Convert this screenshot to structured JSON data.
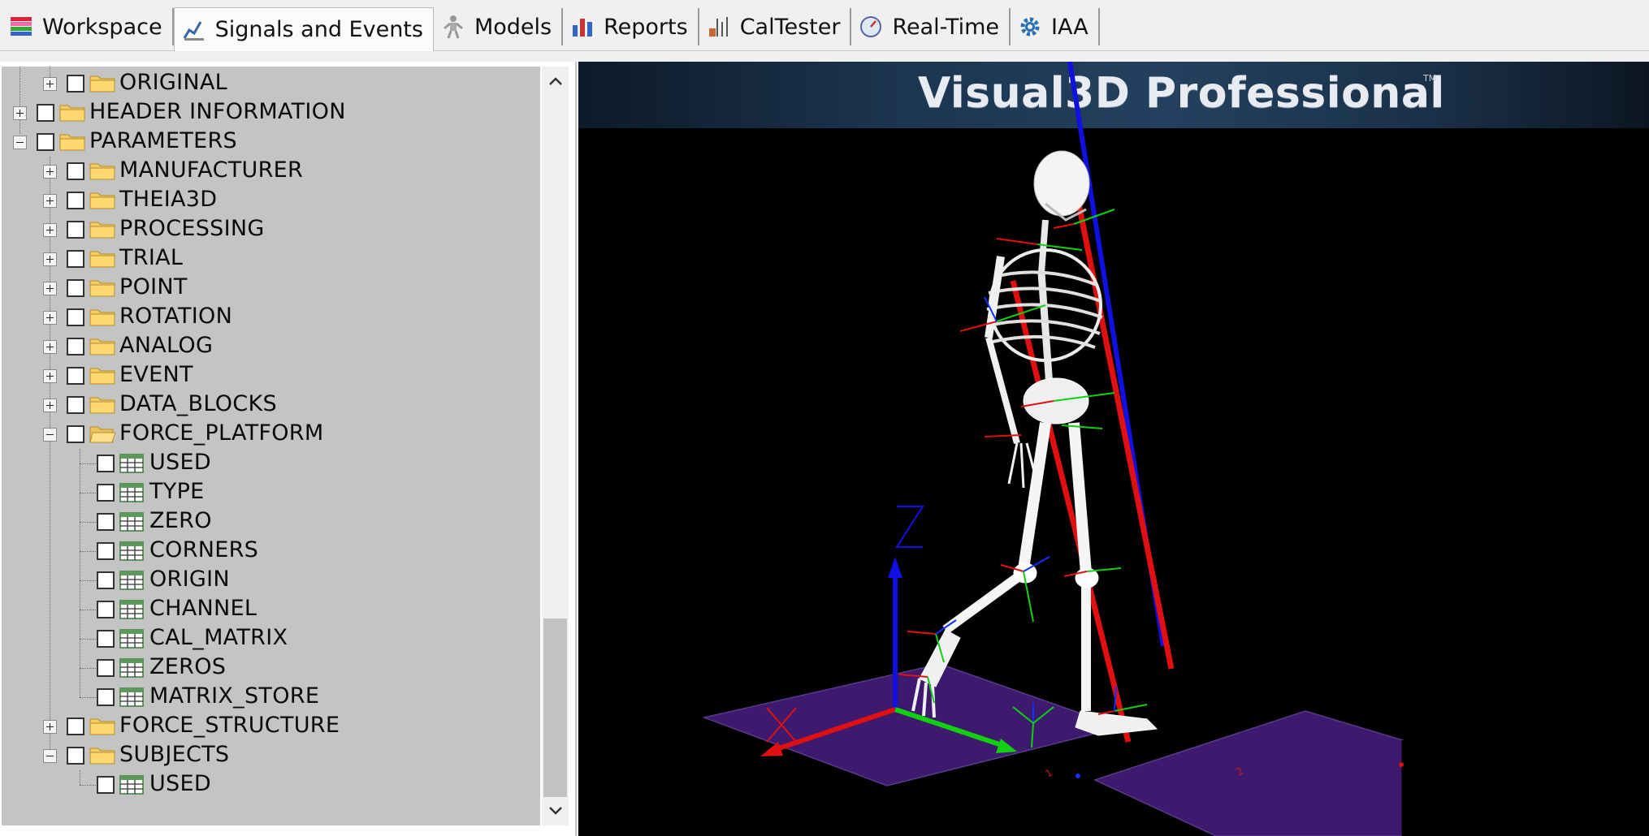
{
  "tabs": [
    {
      "label": "Workspace",
      "icon": "workspace-icon",
      "active": false
    },
    {
      "label": "Signals and Events",
      "icon": "signals-icon",
      "active": true
    },
    {
      "label": "Models",
      "icon": "models-icon",
      "active": false
    },
    {
      "label": "Reports",
      "icon": "reports-icon",
      "active": false
    },
    {
      "label": "CalTester",
      "icon": "caltester-icon",
      "active": false
    },
    {
      "label": "Real-Time",
      "icon": "realtime-icon",
      "active": false
    },
    {
      "label": "IAA",
      "icon": "gear-icon",
      "active": false
    }
  ],
  "tree": [
    {
      "label": "ORIGINAL",
      "level": 1,
      "kind": "folder",
      "expander": "plus"
    },
    {
      "label": "HEADER INFORMATION",
      "level": 0,
      "kind": "folder",
      "expander": "plus"
    },
    {
      "label": "PARAMETERS",
      "level": 0,
      "kind": "folder",
      "expander": "minus"
    },
    {
      "label": "MANUFACTURER",
      "level": 1,
      "kind": "folder",
      "expander": "plus"
    },
    {
      "label": "THEIA3D",
      "level": 1,
      "kind": "folder",
      "expander": "plus"
    },
    {
      "label": "PROCESSING",
      "level": 1,
      "kind": "folder",
      "expander": "plus"
    },
    {
      "label": "TRIAL",
      "level": 1,
      "kind": "folder",
      "expander": "plus"
    },
    {
      "label": "POINT",
      "level": 1,
      "kind": "folder",
      "expander": "plus"
    },
    {
      "label": "ROTATION",
      "level": 1,
      "kind": "folder",
      "expander": "plus"
    },
    {
      "label": "ANALOG",
      "level": 1,
      "kind": "folder",
      "expander": "plus"
    },
    {
      "label": "EVENT",
      "level": 1,
      "kind": "folder",
      "expander": "plus"
    },
    {
      "label": "DATA_BLOCKS",
      "level": 1,
      "kind": "folder",
      "expander": "plus"
    },
    {
      "label": "FORCE_PLATFORM",
      "level": 1,
      "kind": "folder-open",
      "expander": "minus"
    },
    {
      "label": "USED",
      "level": 2,
      "kind": "table",
      "expander": "none"
    },
    {
      "label": "TYPE",
      "level": 2,
      "kind": "table",
      "expander": "none"
    },
    {
      "label": "ZERO",
      "level": 2,
      "kind": "table",
      "expander": "none"
    },
    {
      "label": "CORNERS",
      "level": 2,
      "kind": "table",
      "expander": "none"
    },
    {
      "label": "ORIGIN",
      "level": 2,
      "kind": "table",
      "expander": "none"
    },
    {
      "label": "CHANNEL",
      "level": 2,
      "kind": "table",
      "expander": "none"
    },
    {
      "label": "CAL_MATRIX",
      "level": 2,
      "kind": "table",
      "expander": "none"
    },
    {
      "label": "ZEROS",
      "level": 2,
      "kind": "table",
      "expander": "none"
    },
    {
      "label": "MATRIX_STORE",
      "level": 2,
      "kind": "table",
      "expander": "none"
    },
    {
      "label": "FORCE_STRUCTURE",
      "level": 1,
      "kind": "folder",
      "expander": "plus"
    },
    {
      "label": "SUBJECTS",
      "level": 1,
      "kind": "folder",
      "expander": "minus"
    },
    {
      "label": "USED",
      "level": 2,
      "kind": "table",
      "expander": "none"
    }
  ],
  "viewport": {
    "banner_title": "Visual3D Professional",
    "banner_tm": "TM",
    "axis_z_label": "Z",
    "axis_x_label": "X",
    "background": "#000000",
    "plate_color": "#3d1a6e",
    "grf_color": "#e01010",
    "axis_colors": {
      "x": "#e01010",
      "y": "#10d010",
      "z": "#1010e0"
    }
  }
}
